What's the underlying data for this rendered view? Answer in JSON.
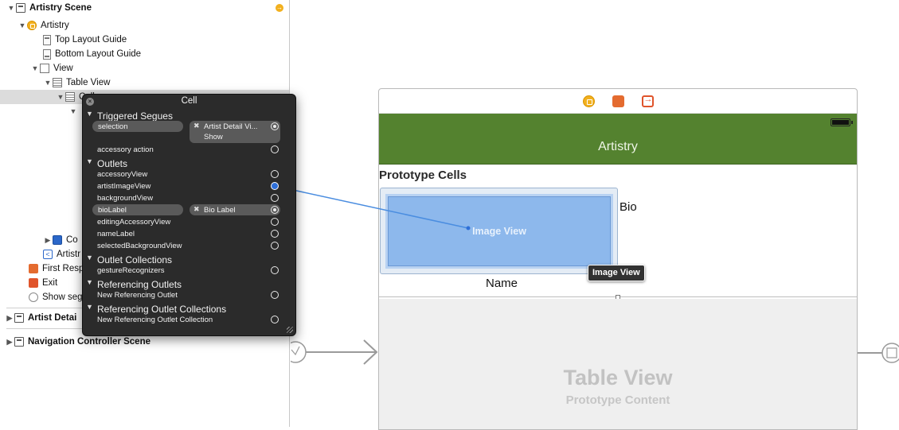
{
  "outline": {
    "items": [
      {
        "label": "Artistry Scene",
        "kind": "scene",
        "expanded": true
      },
      {
        "label": "Artistry",
        "kind": "vc",
        "expanded": true
      },
      {
        "label": "Top Layout Guide",
        "kind": "guide"
      },
      {
        "label": "Bottom Layout Guide",
        "kind": "guide-bottom"
      },
      {
        "label": "View",
        "kind": "view",
        "expanded": true
      },
      {
        "label": "Table View",
        "kind": "table",
        "expanded": true
      },
      {
        "label": "Cell",
        "kind": "table",
        "expanded": true
      },
      {
        "label": "Co",
        "kind": "blue"
      },
      {
        "label": "Artistr",
        "kind": "back"
      },
      {
        "label": "First Resp",
        "kind": "cube"
      },
      {
        "label": "Exit",
        "kind": "exit"
      },
      {
        "label": "Show seg",
        "kind": "circ"
      },
      {
        "label": "Artist Detai",
        "kind": "scene"
      },
      {
        "label": "Navigation Controller Scene",
        "kind": "scene"
      }
    ]
  },
  "hud": {
    "title": "Cell",
    "sections": {
      "triggered_segues": "Triggered Segues",
      "outlets": "Outlets",
      "outlet_collections": "Outlet Collections",
      "referencing_outlets": "Referencing Outlets",
      "referencing_outlet_collections": "Referencing Outlet Collections"
    },
    "rows": {
      "selection": "selection",
      "selection_target": "Artist Detail Vi...",
      "selection_kind": "Show",
      "accessory_action": "accessory action",
      "accessoryView": "accessoryView",
      "artistImageView": "artistImageView",
      "backgroundView": "backgroundView",
      "bioLabel": "bioLabel",
      "bioLabel_target": "Bio Label",
      "editingAccessoryView": "editingAccessoryView",
      "nameLabel": "nameLabel",
      "selectedBackgroundView": "selectedBackgroundView",
      "gestureRecognizers": "gestureRecognizers",
      "new_referencing_outlet": "New Referencing Outlet",
      "new_referencing_outlet_collection": "New Referencing Outlet Collection"
    }
  },
  "canvas": {
    "navbar_title": "Artistry",
    "prototype_header": "Prototype Cells",
    "image_view_label": "Image View",
    "bio_label": "Bio",
    "name_label": "Name",
    "tooltip": "Image View",
    "table_placeholder_title": "Table View",
    "table_placeholder_subtitle": "Prototype Content"
  },
  "colors": {
    "navbar": "#54822f",
    "image_view": "#8db8ec",
    "hud_background": "#2b2b2b",
    "connection_line": "#2e6fd8"
  }
}
